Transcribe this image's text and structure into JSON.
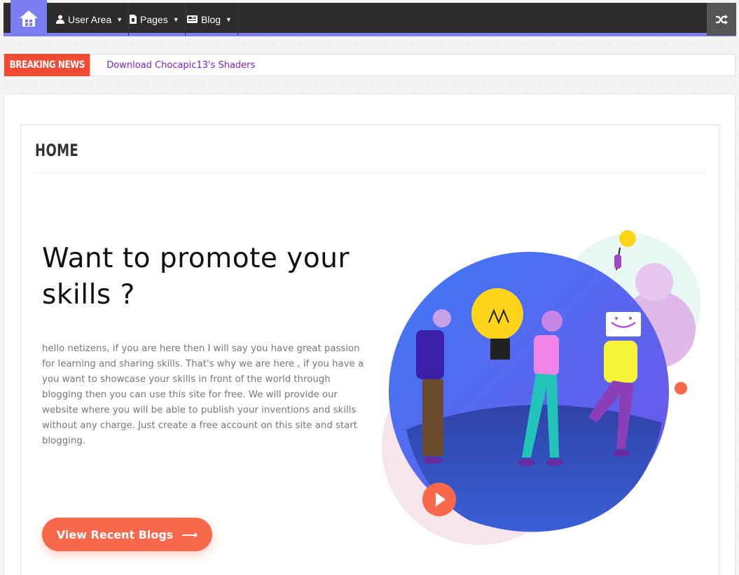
{
  "nav": {
    "items": [
      {
        "label": "User Area",
        "icon": "user-icon"
      },
      {
        "label": "Pages",
        "icon": "document-icon"
      },
      {
        "label": "Blog",
        "icon": "newspaper-icon"
      }
    ],
    "accent": "#7b7df3"
  },
  "breaking": {
    "label": "BREAKING NEWS",
    "headline": "Download Chocapic13's Shaders"
  },
  "page": {
    "title": "HOME",
    "heading": "Want to promote your skills ?",
    "body": "hello netizens, if you are here then I will say you have great passion for learning and sharing skills. That's why we are here , if you have a you want to showcase your skills in front of the world through blogging then you can use this site for free. We will provide our website where you will be able to publish your inventions and skills without any charge. Just create a free account on this site and start blogging.",
    "cta_label": "View Recent Blogs"
  },
  "colors": {
    "cta": "#f8694c",
    "breaking": "#f04a32"
  }
}
